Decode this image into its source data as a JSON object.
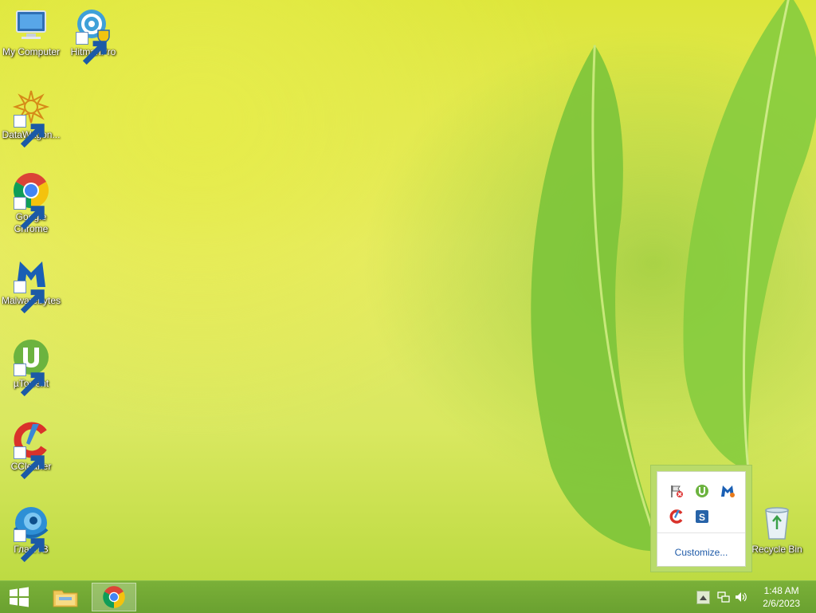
{
  "desktop": {
    "icons": [
      {
        "label": "My Computer",
        "icon": "computer-icon"
      },
      {
        "label": "HitmanPro",
        "icon": "hitmanpro-icon"
      },
      {
        "label": "DataWagon...",
        "icon": "datawagon-icon"
      },
      {
        "label": "Google Chrome",
        "icon": "chrome-icon"
      },
      {
        "label": "Malwarebytes",
        "icon": "malwarebytes-icon"
      },
      {
        "label": "µTorrent",
        "icon": "utorrent-icon"
      },
      {
        "label": "CCleaner",
        "icon": "ccleaner-icon"
      },
      {
        "label": "Глаз.ТВ",
        "icon": "glaz-tv-icon"
      },
      {
        "label": "Recycle Bin",
        "icon": "recycle-bin-icon"
      }
    ]
  },
  "tray_popup": {
    "customize_label": "Customize...",
    "icons": [
      "action-center-flag-icon",
      "utorrent-tray-icon",
      "malwarebytes-tray-icon",
      "ccleaner-tray-icon",
      "security-shield-tray-icon"
    ]
  },
  "taskbar": {
    "pinned": [
      "file-explorer-icon",
      "chrome-icon"
    ],
    "active": "chrome-icon",
    "tray_icons": [
      "show-hidden-icons-arrow",
      "network-icon",
      "volume-icon"
    ],
    "time": "1:48 AM",
    "date": "2/6/2023"
  },
  "colors": {
    "taskbar": "#6aa130",
    "popup_border": "#b9db6a",
    "link": "#1e5aa8"
  }
}
